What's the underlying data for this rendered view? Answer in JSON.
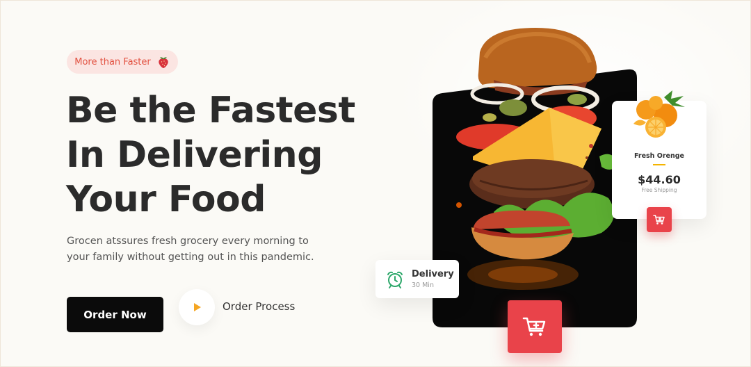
{
  "hero": {
    "badge_text": "More than Faster",
    "headline_line1": "Be the Fastest",
    "headline_line2": "In Delivering",
    "headline_line3": "Your Food",
    "description": "Grocen atssures fresh grocery every morning to your family without getting out in this pandemic.",
    "order_now_label": "Order Now",
    "order_process_label": "Order Process"
  },
  "delivery_card": {
    "title": "Delivery",
    "subtitle": "30 Min",
    "icon": "alarm-clock-icon"
  },
  "product_card": {
    "name": "Fresh Orenge",
    "price": "$44.60",
    "shipping": "Free Shipping",
    "image": "orange-fruit-image"
  },
  "icons": {
    "badge": "strawberry-icon",
    "play": "play-icon",
    "cart": "shopping-cart-add-icon"
  },
  "colors": {
    "accent_red": "#e9434a",
    "badge_bg": "#fbe5e2",
    "badge_text": "#e2503f",
    "play_orange": "#f5a623",
    "clock_green": "#2ea86b",
    "primary_button": "#0b0b0b"
  }
}
